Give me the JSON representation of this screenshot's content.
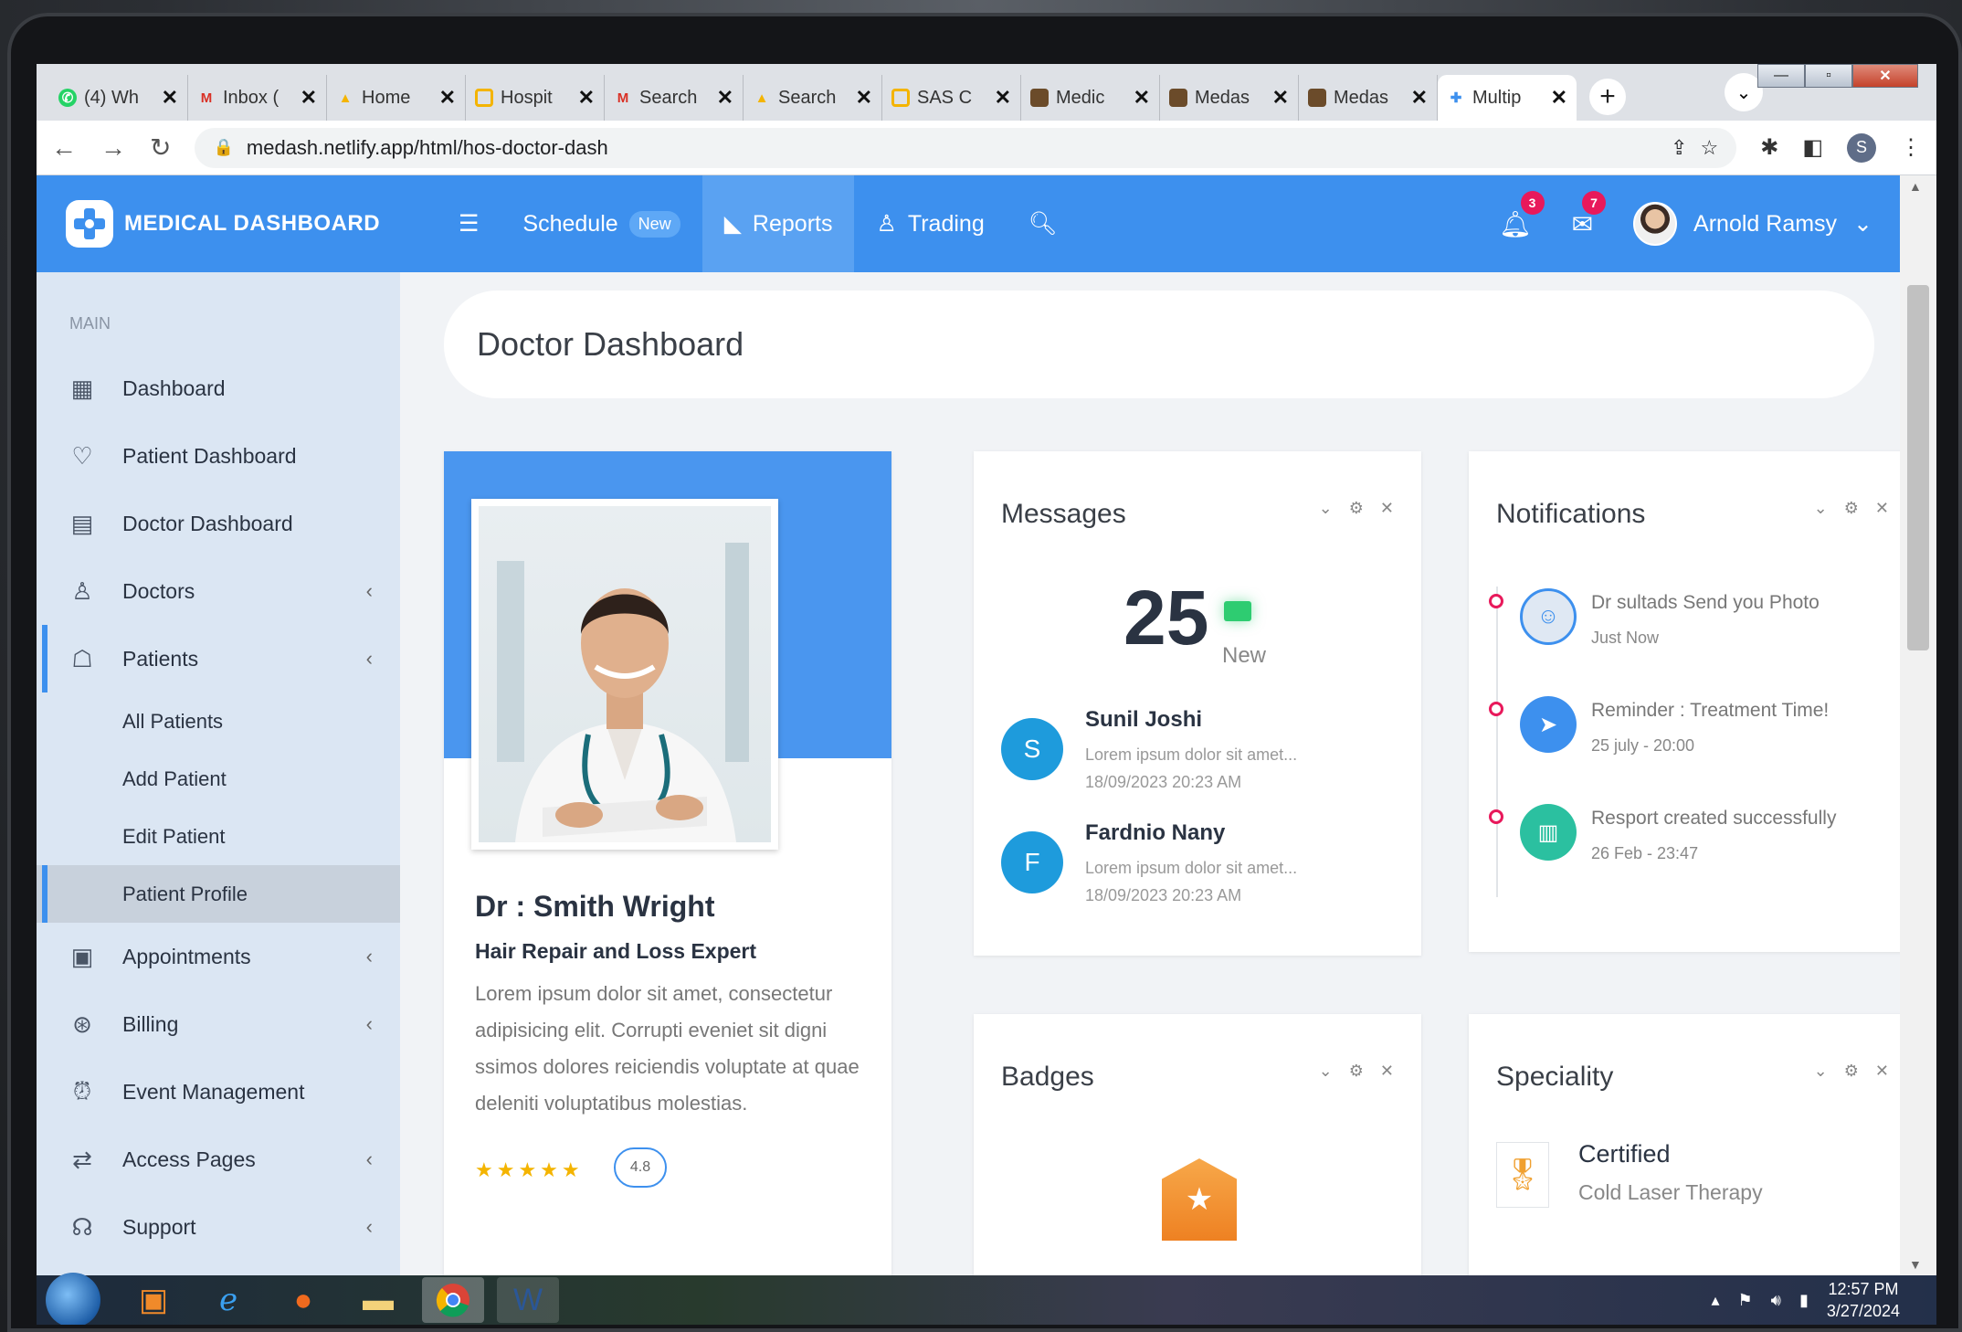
{
  "browser": {
    "tabs": [
      {
        "label": "(4) Wh",
        "icon": "whatsapp-icon",
        "color": "#25d366"
      },
      {
        "label": "Inbox (",
        "icon": "gmail-icon",
        "color": "#d93025"
      },
      {
        "label": "Home",
        "icon": "drive-icon",
        "color": "#f4b400"
      },
      {
        "label": "Hospit",
        "icon": "slides-icon",
        "color": "#f4b400"
      },
      {
        "label": "Search",
        "icon": "gmail-icon",
        "color": "#d93025"
      },
      {
        "label": "Search",
        "icon": "drive-icon",
        "color": "#f4b400"
      },
      {
        "label": "SAS C",
        "icon": "slides-icon",
        "color": "#f4b400"
      },
      {
        "label": "Medic",
        "icon": "book-icon",
        "color": "#6b4b2a"
      },
      {
        "label": "Medas",
        "icon": "book-icon",
        "color": "#6b4b2a"
      },
      {
        "label": "Medas",
        "icon": "book-icon",
        "color": "#6b4b2a"
      },
      {
        "label": "Multip",
        "icon": "medical-logo-icon",
        "color": "#3d90ee",
        "active": true
      }
    ],
    "url": "medash.netlify.app/html/hos-doctor-dash",
    "profile_initial": "S"
  },
  "header": {
    "logo_text": "MEDICAL DASHBOARD",
    "nav": {
      "schedule": "Schedule",
      "schedule_badge": "New",
      "reports": "Reports",
      "trading": "Trading"
    },
    "notif_count": "3",
    "mail_count": "7",
    "user_name": "Arnold Ramsy"
  },
  "sidebar": {
    "section": "MAIN",
    "items": {
      "dashboard": "Dashboard",
      "patient_dashboard": "Patient Dashboard",
      "doctor_dashboard": "Doctor Dashboard",
      "doctors": "Doctors",
      "patients": "Patients",
      "all_patients": "All Patients",
      "add_patient": "Add Patient",
      "edit_patient": "Edit Patient",
      "patient_profile": "Patient Profile",
      "appointments": "Appointments",
      "billing": "Billing",
      "event_management": "Event Management",
      "access_pages": "Access Pages",
      "support": "Support"
    }
  },
  "page": {
    "title": "Doctor Dashboard"
  },
  "profile": {
    "name": "Dr : Smith Wright",
    "role": "Hair Repair and Loss Expert",
    "bio": "Lorem ipsum dolor sit amet, consectetur adipisicing elit. Corrupti eveniet sit digni ssimos dolores reiciendis voluptate at quae deleniti voluptatibus molestias.",
    "stars": "★★★★★",
    "rating": "4.8"
  },
  "messages": {
    "title": "Messages",
    "count": "25",
    "count_label": "New",
    "items": [
      {
        "initial": "S",
        "name": "Sunil Joshi",
        "text": "Lorem ipsum dolor sit amet...",
        "time": "18/09/2023 20:23 AM"
      },
      {
        "initial": "F",
        "name": "Fardnio Nany",
        "text": "Lorem ipsum dolor sit amet...",
        "time": "18/09/2023 20:23 AM"
      }
    ]
  },
  "notifications": {
    "title": "Notifications",
    "items": [
      {
        "title": "Dr sultads Send you Photo",
        "sub": "Just Now",
        "color": "#dfe8f3"
      },
      {
        "title": "Reminder : Treatment Time!",
        "sub": "25 july - 20:00",
        "color": "#3d90ee"
      },
      {
        "title": "Resport created successfully",
        "sub": "26 Feb - 23:47",
        "color": "#2bc0a0"
      }
    ]
  },
  "badges": {
    "title": "Badges"
  },
  "speciality": {
    "title": "Speciality",
    "item_title": "Certified",
    "item_sub": "Cold Laser Therapy"
  },
  "taskbar": {
    "time": "12:57 PM",
    "date": "3/27/2024"
  }
}
